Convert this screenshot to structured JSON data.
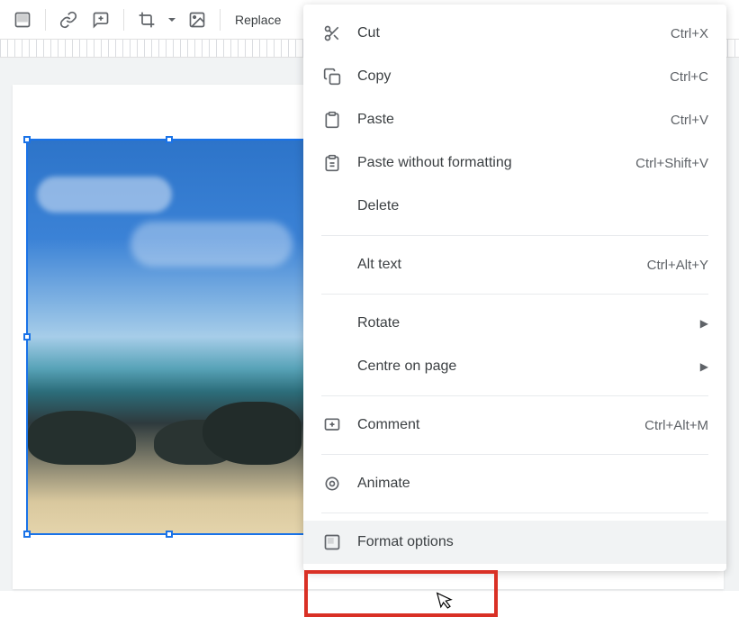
{
  "toolbar": {
    "replace_label": "Replace"
  },
  "context_menu": {
    "cut": {
      "label": "Cut",
      "shortcut": "Ctrl+X"
    },
    "copy": {
      "label": "Copy",
      "shortcut": "Ctrl+C"
    },
    "paste": {
      "label": "Paste",
      "shortcut": "Ctrl+V"
    },
    "paste_plain": {
      "label": "Paste without formatting",
      "shortcut": "Ctrl+Shift+V"
    },
    "delete": {
      "label": "Delete"
    },
    "alt_text": {
      "label": "Alt text",
      "shortcut": "Ctrl+Alt+Y"
    },
    "rotate": {
      "label": "Rotate"
    },
    "centre": {
      "label": "Centre on page"
    },
    "comment": {
      "label": "Comment",
      "shortcut": "Ctrl+Alt+M"
    },
    "animate": {
      "label": "Animate"
    },
    "format_options": {
      "label": "Format options"
    }
  }
}
